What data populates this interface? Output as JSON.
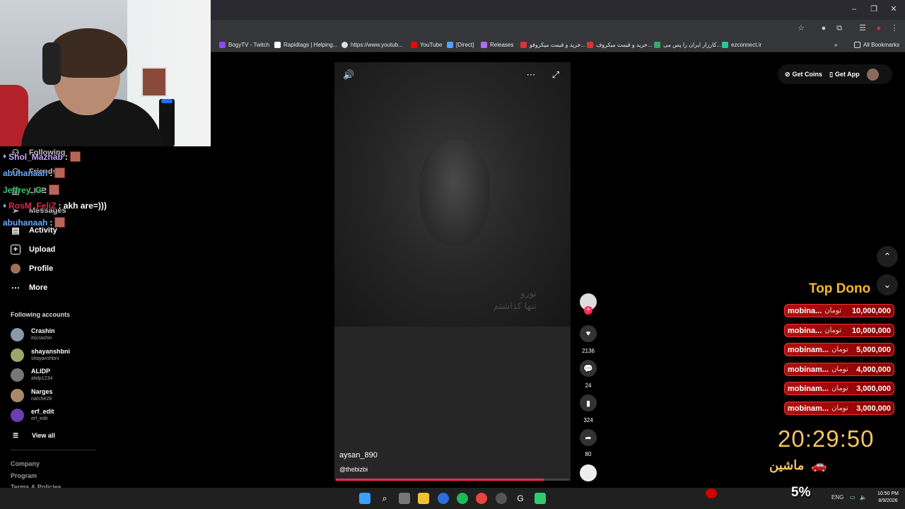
{
  "bookmarks": [
    {
      "label": "BogyTV - Twitch",
      "color": "#9146ff"
    },
    {
      "label": "Rapidtags | Helping...",
      "color": "#ffffff"
    },
    {
      "label": "https://www.youtub...",
      "color": "#dddddd"
    },
    {
      "label": "YouTube",
      "color": "#ff0000"
    },
    {
      "label": "[Direct]",
      "color": "#4da3ff"
    },
    {
      "label": "Releases",
      "color": "#b36bff"
    },
    {
      "label": "خرید و قیمت میکروفو...",
      "color": "#d33"
    },
    {
      "label": "خرید و قیمت میکروف...",
      "color": "#d33"
    },
    {
      "label": "کارزار ایران را پس می...",
      "color": "#3a6"
    },
    {
      "label": "ezconnect.ir",
      "color": "#2c9"
    }
  ],
  "all_bookmarks": "All Bookmarks",
  "nav": {
    "following": "Following",
    "friends": "Friends",
    "live": "LIVE",
    "messages": "Messages",
    "activity": "Activity",
    "upload": "Upload",
    "profile": "Profile",
    "more": "More"
  },
  "following_title": "Following accounts",
  "accounts": [
    {
      "name": "Crashin",
      "handle": "itscrashin",
      "color": "#8899aa"
    },
    {
      "name": "shayanshbni",
      "handle": "shayanshbni",
      "color": "#9aa86b"
    },
    {
      "name": "ALIDP",
      "handle": "alidp1234",
      "color": "#777777"
    },
    {
      "name": "Narges",
      "handle": "narche28",
      "color": "#a88a6a"
    },
    {
      "name": "erf_edit",
      "handle": "erf_edit",
      "color": "#6a3fb0"
    }
  ],
  "view_all": "View all",
  "footer": [
    "Company",
    "Program",
    "Terms & Policies"
  ],
  "chat": [
    {
      "user": "Shol_Mazhab",
      "color": "#c9a6ff",
      "msg": ":"
    },
    {
      "user": "abuhanaah",
      "color": "#6aa9ff",
      "msg": ":"
    },
    {
      "user": "Jeffrey_G",
      "color": "#35c46a",
      "msg": ":"
    },
    {
      "user": "RosM_FeliZ",
      "color": "#e0284e",
      "msg": ": akh are=)))"
    },
    {
      "user": "abuhanaah",
      "color": "#6aa9ff",
      "msg": ":"
    }
  ],
  "video": {
    "overlay_line1": "تورو",
    "overlay_line2": "تنها کداشتم",
    "username": "aysan_890",
    "handle": "@thebizbi",
    "progress": 0.89
  },
  "rail": {
    "likes": "2136",
    "comments": "24",
    "saves": "324",
    "shares": "80"
  },
  "top_right": {
    "get_coins": "Get Coins",
    "get_app": "Get App"
  },
  "dono": {
    "title": "Top Dono",
    "currency": "تومان",
    "rows": [
      {
        "name": "mobina...",
        "amount": "10,000,000"
      },
      {
        "name": "mobina...",
        "amount": "10,000,000"
      },
      {
        "name": "mobinam...",
        "amount": "5,000,000"
      },
      {
        "name": "mobinam...",
        "amount": "4,000,000"
      },
      {
        "name": "mobinam...",
        "amount": "3,000,000"
      },
      {
        "name": "mobinam...",
        "amount": "3,000,000"
      }
    ]
  },
  "stream_clock": "20:29:50",
  "car_label": "ماشین",
  "percent": "5%",
  "tray": {
    "lang": "ENG",
    "time": "10:50 PM",
    "date": "8/9/2026"
  }
}
